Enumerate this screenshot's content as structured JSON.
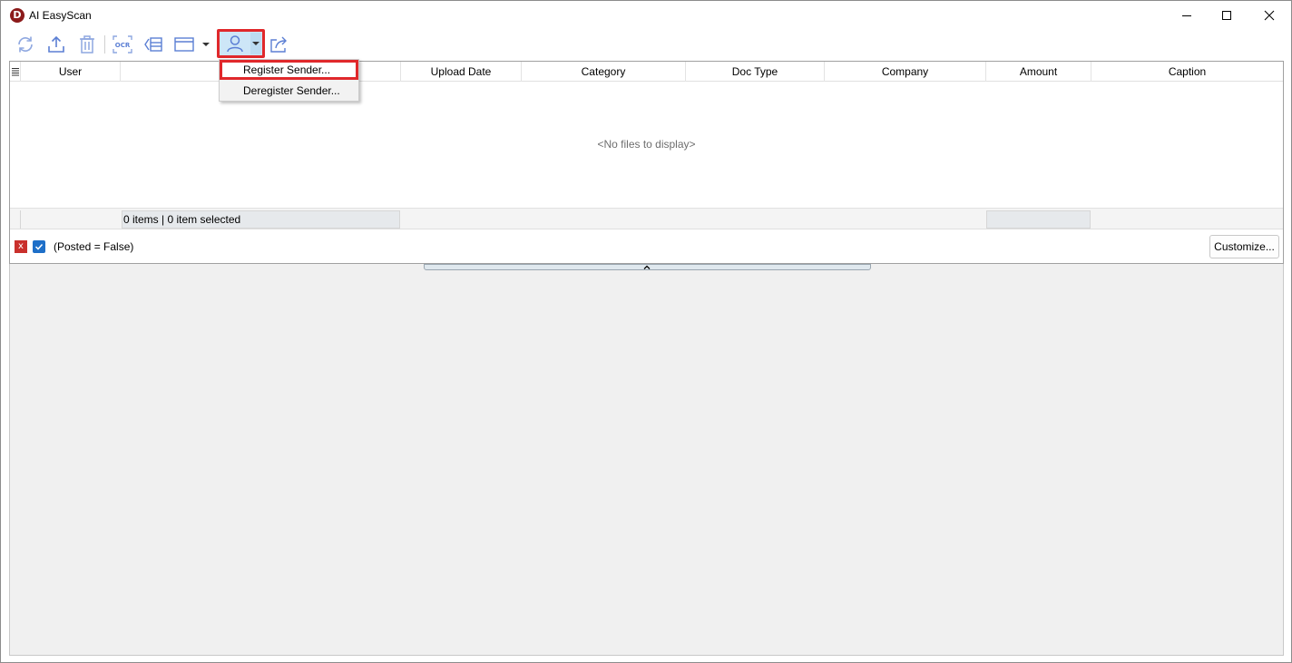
{
  "window": {
    "title": "AI EasyScan",
    "logo_letter": "D",
    "colors": {
      "logo": "#8b1a1a",
      "highlight": "#e0282b",
      "icon": "#5b7fd4"
    }
  },
  "toolbar": {
    "icons": [
      "refresh-icon",
      "upload-icon",
      "delete-icon",
      "ocr-icon",
      "split-icon",
      "layout-icon",
      "user-icon",
      "share-icon"
    ],
    "ocr_label": "OCR"
  },
  "user_menu": {
    "items": [
      {
        "label": "Register Sender..."
      },
      {
        "label": "Deregister Sender..."
      }
    ]
  },
  "grid": {
    "columns": [
      "User",
      "",
      "Upload Date",
      "Category",
      "Doc Type",
      "Company",
      "Amount",
      "Caption"
    ],
    "empty_message": "<No files to display>",
    "footer": {
      "summary": "0 items |  0 item selected"
    }
  },
  "filter": {
    "remove_label": "x",
    "expression": "(Posted = False)",
    "enabled": true,
    "customize_label": "Customize..."
  }
}
